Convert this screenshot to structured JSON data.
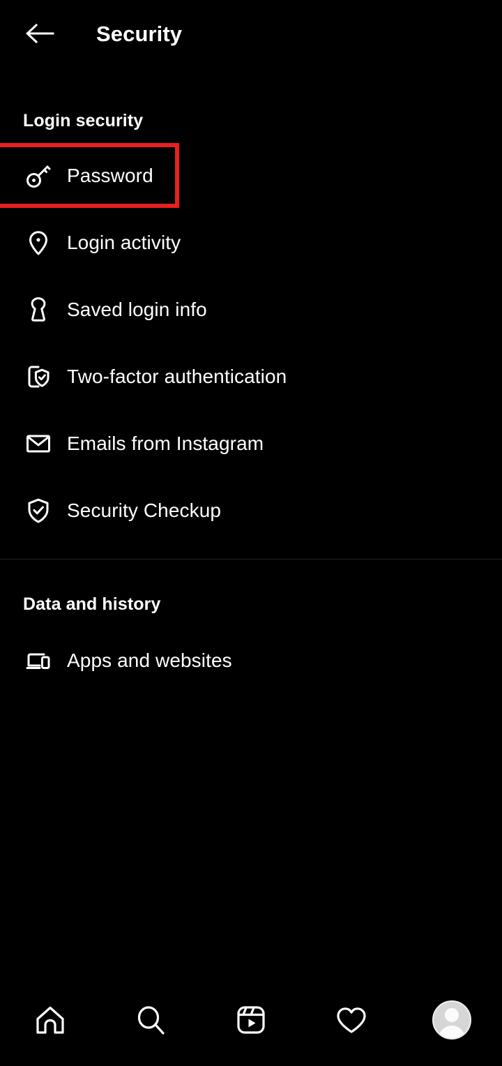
{
  "header": {
    "back_icon": "arrow-left-icon",
    "title": "Security"
  },
  "sections": [
    {
      "id": "login-security",
      "title": "Login security",
      "items": [
        {
          "label": "Password",
          "icon": "key-icon",
          "highlighted": true
        },
        {
          "label": "Login activity",
          "icon": "location-pin-icon",
          "highlighted": false
        },
        {
          "label": "Saved login info",
          "icon": "keyhole-icon",
          "highlighted": false
        },
        {
          "label": "Two-factor authentication",
          "icon": "phone-shield-check-icon",
          "highlighted": false
        },
        {
          "label": "Emails from Instagram",
          "icon": "envelope-icon",
          "highlighted": false
        },
        {
          "label": "Security Checkup",
          "icon": "shield-check-icon",
          "highlighted": false
        }
      ]
    },
    {
      "id": "data-and-history",
      "title": "Data and history",
      "items": [
        {
          "label": "Apps and websites",
          "icon": "devices-icon",
          "highlighted": false
        }
      ]
    }
  ],
  "bottom_nav": [
    {
      "name": "home",
      "icon": "home-icon"
    },
    {
      "name": "search",
      "icon": "search-icon"
    },
    {
      "name": "reels",
      "icon": "reels-icon"
    },
    {
      "name": "activity",
      "icon": "heart-icon"
    },
    {
      "name": "profile",
      "icon": "avatar-icon"
    }
  ],
  "colors": {
    "background": "#000000",
    "text": "#ffffff",
    "highlight": "#e8201f",
    "divider": "#242424",
    "avatar": "#d6d6d6"
  }
}
